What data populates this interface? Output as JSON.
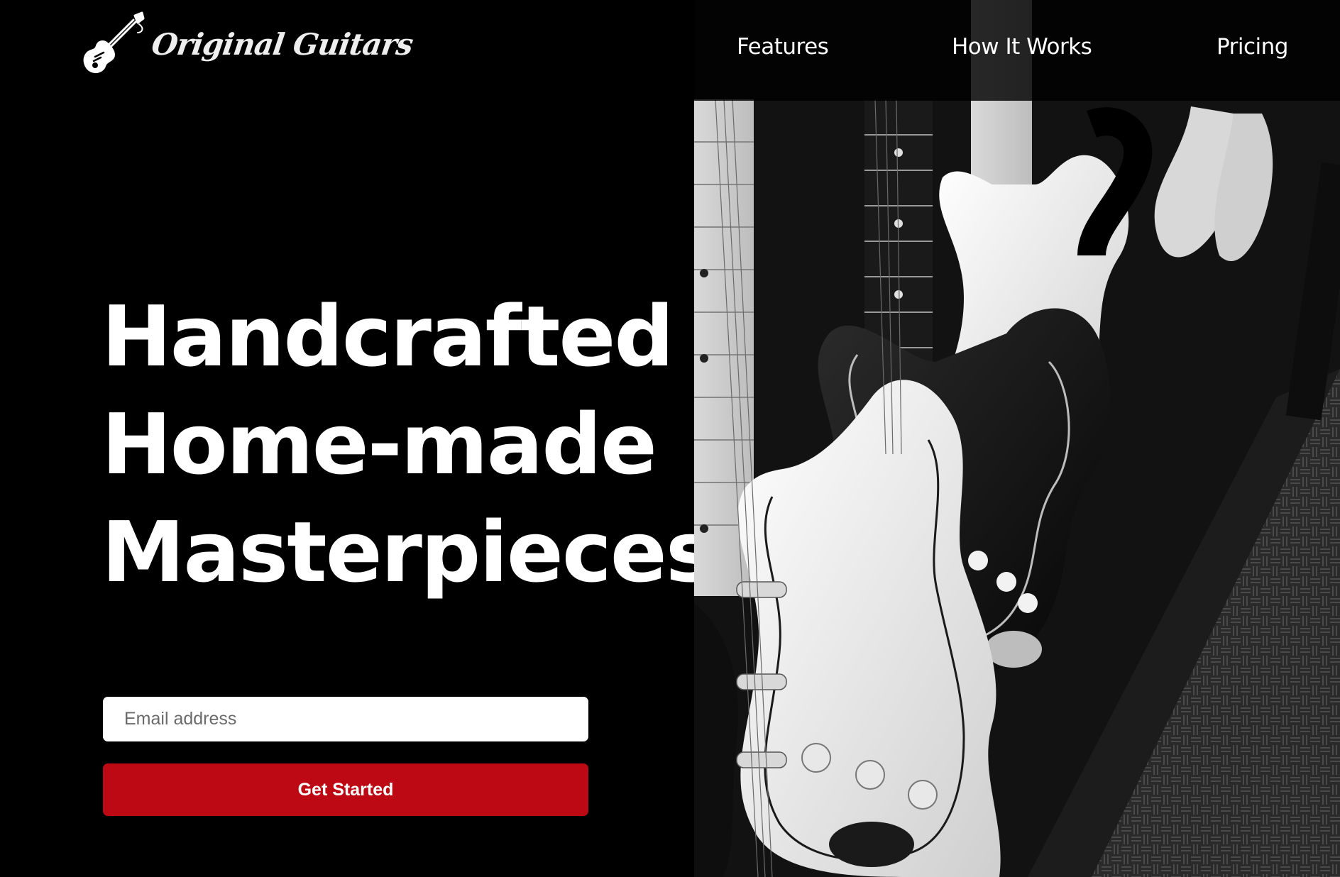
{
  "brand": {
    "name": "Original Guitars",
    "logo_icon": "electric-guitar-icon"
  },
  "nav": {
    "items": [
      {
        "label": "Features"
      },
      {
        "label": "How It Works"
      },
      {
        "label": "Pricing"
      }
    ]
  },
  "hero": {
    "headline_lines": [
      "Handcrafted",
      "Home-made",
      "Masterpieces."
    ],
    "email_placeholder": "Email address",
    "email_value": "",
    "cta_label": "Get Started",
    "cta_color": "#bd0913",
    "background_color": "#000000"
  }
}
